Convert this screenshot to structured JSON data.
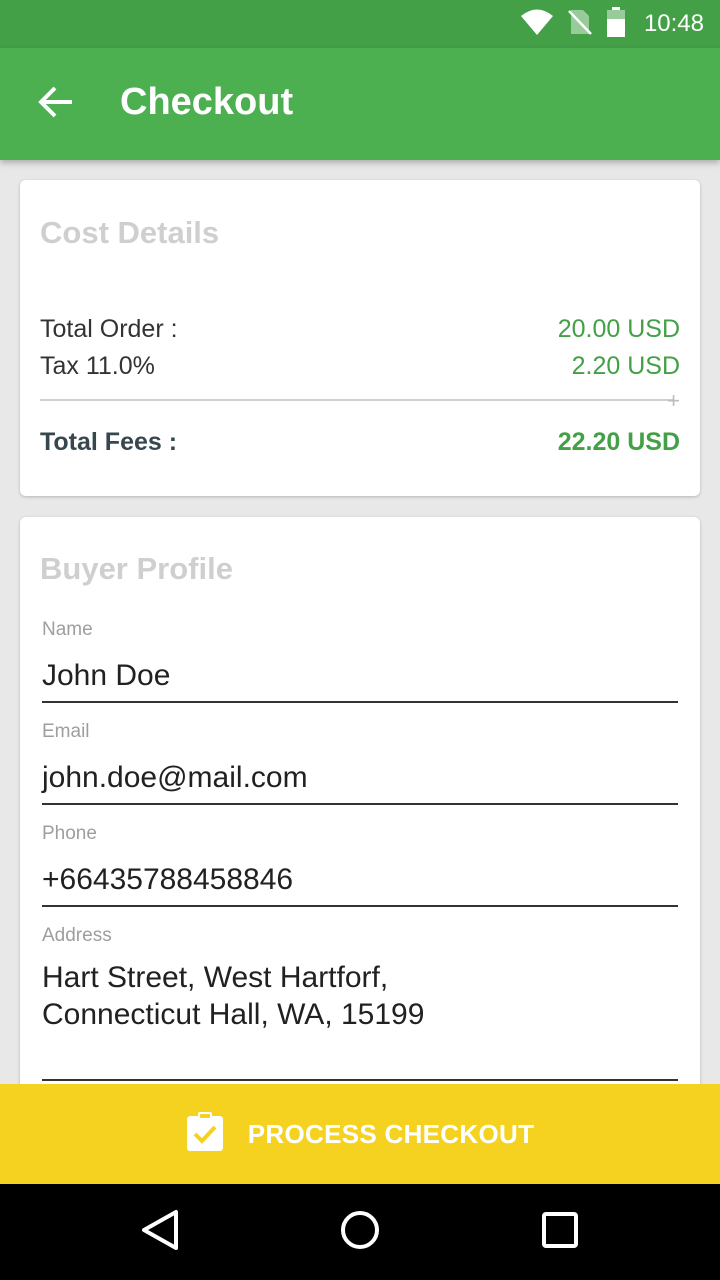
{
  "status_bar": {
    "time": "10:48"
  },
  "app_bar": {
    "title": "Checkout"
  },
  "cost_details": {
    "title": "Cost Details",
    "rows": [
      {
        "label": "Total Order :",
        "value": "20.00 USD"
      },
      {
        "label": "Tax 11.0%",
        "value": "2.20 USD"
      }
    ],
    "operator": "+",
    "total": {
      "label": "Total Fees :",
      "value": "22.20 USD"
    }
  },
  "buyer_profile": {
    "title": "Buyer Profile",
    "name": {
      "label": "Name",
      "value": "John Doe"
    },
    "email": {
      "label": "Email",
      "value": "john.doe@mail.com"
    },
    "phone": {
      "label": "Phone",
      "value": "+66435788458846"
    },
    "address": {
      "label": "Address",
      "value": "Hart Street, West Hartforf,\nConnecticut Hall, WA, 15199"
    }
  },
  "checkout_button": {
    "label": "PROCESS CHECKOUT"
  },
  "colors": {
    "status_bar": "#43a047",
    "app_bar": "#4caf50",
    "price_green": "#43a047",
    "checkout_yellow": "#f4d21f"
  }
}
